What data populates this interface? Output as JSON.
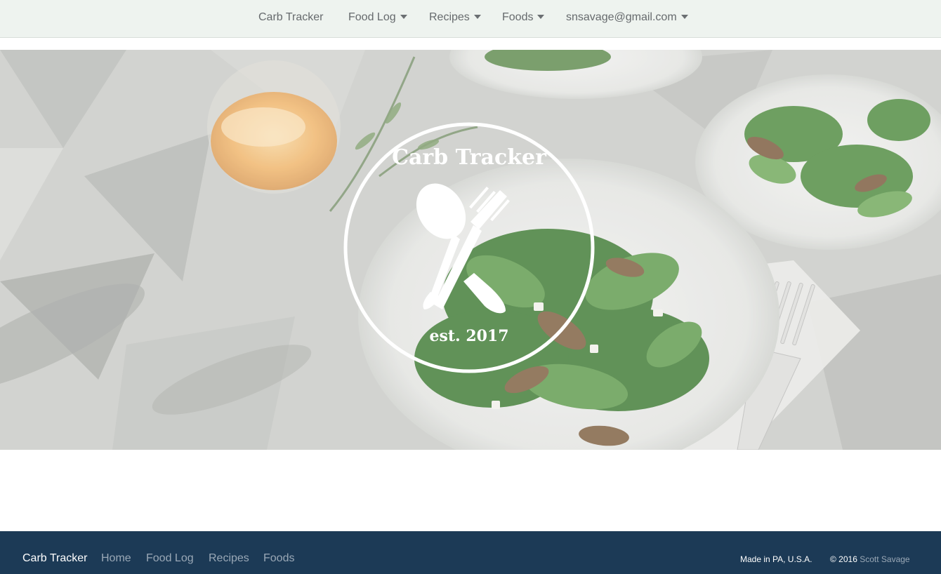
{
  "nav": {
    "brand": "Carb Tracker",
    "food_log": "Food Log",
    "recipes": "Recipes",
    "foods": "Foods",
    "user_email": "snsavage@gmail.com"
  },
  "hero": {
    "logo_title": "Carb Tracker",
    "logo_est": "est. 2017"
  },
  "footer": {
    "brand": "Carb Tracker",
    "links": [
      "Home",
      "Food Log",
      "Recipes",
      "Foods"
    ],
    "made_in": "Made in PA, U.S.A.",
    "copyright": "© 2016",
    "author": "Scott Savage"
  },
  "colors": {
    "nav_bg": "#eef3ef",
    "footer_bg": "#1c3a56",
    "footer_link": "#9aa8b6"
  }
}
